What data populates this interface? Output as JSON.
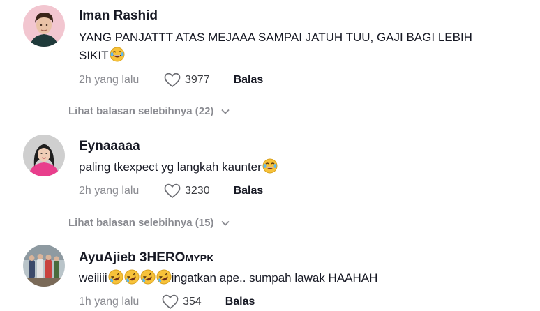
{
  "comments": [
    {
      "username": "Iman Rashid",
      "badge": "",
      "text_line1": "YANG PANJATTT ATAS MEJAAA SAMPAI JATUH TUU, GAJI BAGI LEBIH",
      "text_line2": "SIKIT",
      "emoji": "laughing-tears-emoji",
      "time": "2h yang lalu",
      "likes": "3977",
      "reply_label": "Balas",
      "view_replies": "Lihat balasan selebihnya (22)"
    },
    {
      "username": "Eynaaaaa",
      "badge": "",
      "text_line1": "paling tkexpect yg langkah kaunter",
      "emoji": "laughing-tears-emoji",
      "time": "2h yang lalu",
      "likes": "3230",
      "reply_label": "Balas",
      "view_replies": "Lihat balasan selebihnya (15)"
    },
    {
      "username": "AyuAjieb 3HERO",
      "badge": "MYPK",
      "text_before": "weiiiii",
      "text_after": "ingatkan ape.. sumpah lawak HAAHAH",
      "emoji": "rolling-laughing-emoji",
      "time": "1h yang lalu",
      "likes": "354",
      "reply_label": "Balas"
    }
  ],
  "icons": {
    "like": "heart-outline-icon",
    "expand": "chevron-down-icon"
  },
  "colors": {
    "primary_text": "#161823",
    "secondary_text": "#8a8b91",
    "emoji_yellow": "#f7c23a"
  }
}
